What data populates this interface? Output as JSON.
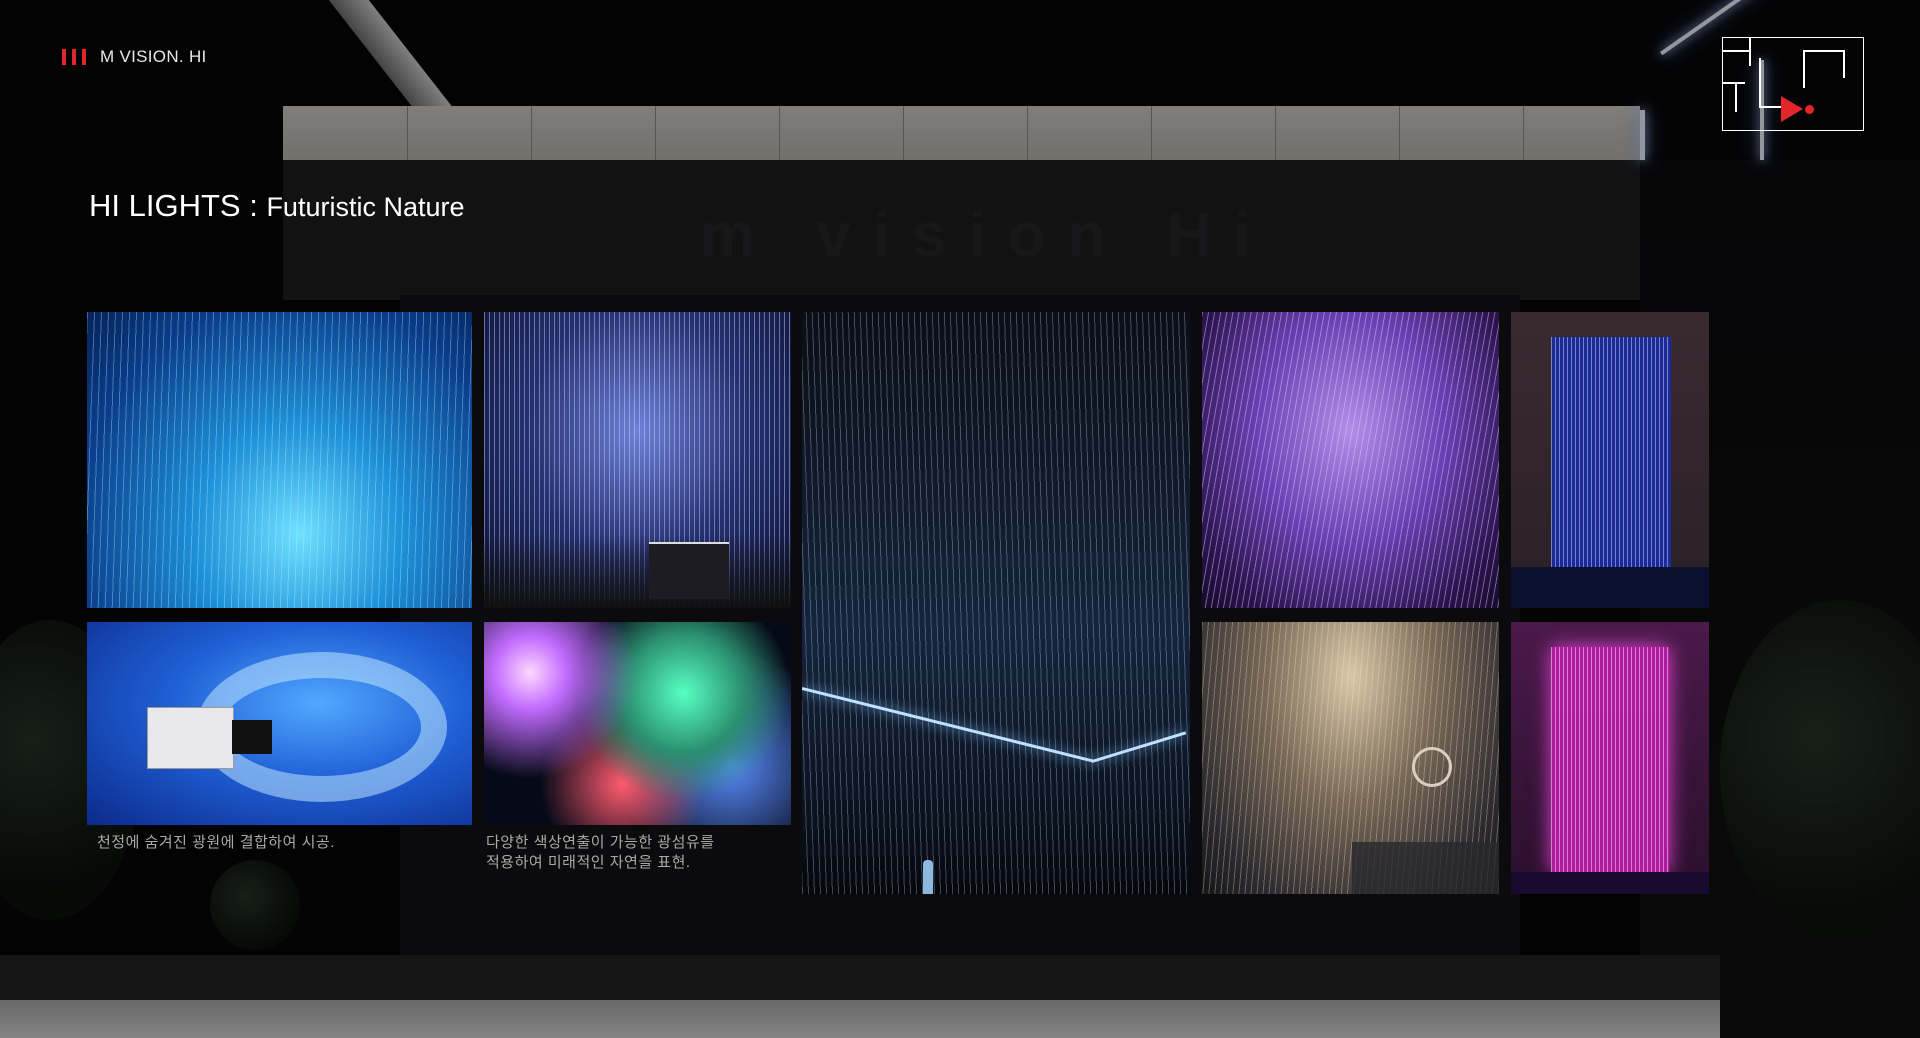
{
  "brand": {
    "name": "M VISION. HI"
  },
  "logo": {
    "icon": "m-vision-hi-logo-icon"
  },
  "title": {
    "main": "HI LIGHTS :",
    "sub": "Futuristic Nature"
  },
  "watermark": "m vision Hi",
  "photos": [
    {
      "name": "fiber-optic-rain-blue",
      "icon": "photo-icon"
    },
    {
      "name": "fiber-optic-curtain-showroom",
      "icon": "photo-icon"
    },
    {
      "name": "fiber-optic-ceiling-rain",
      "icon": "photo-icon"
    },
    {
      "name": "fiber-optic-purple-strands",
      "icon": "photo-icon"
    },
    {
      "name": "fiber-optic-wall-panel-blue",
      "icon": "photo-icon"
    },
    {
      "name": "fiber-optic-light-source-bundle",
      "icon": "photo-icon"
    },
    {
      "name": "fiber-optic-multicolor-tips",
      "icon": "photo-icon"
    },
    {
      "name": "fiber-optic-chandelier-hall",
      "icon": "photo-icon"
    },
    {
      "name": "fiber-optic-wall-panel-magenta",
      "icon": "photo-icon"
    }
  ],
  "captions": {
    "left": "천정에 숨겨진 광원에 결합하여 시공.",
    "center": "다양한 색상연출이 가능한 광섬유를\n적용하여 미래적인 자연을 표현."
  },
  "colors": {
    "accent_red": "#e3262b",
    "text_white": "#ffffff",
    "caption_gray": "#a9a9a9"
  }
}
